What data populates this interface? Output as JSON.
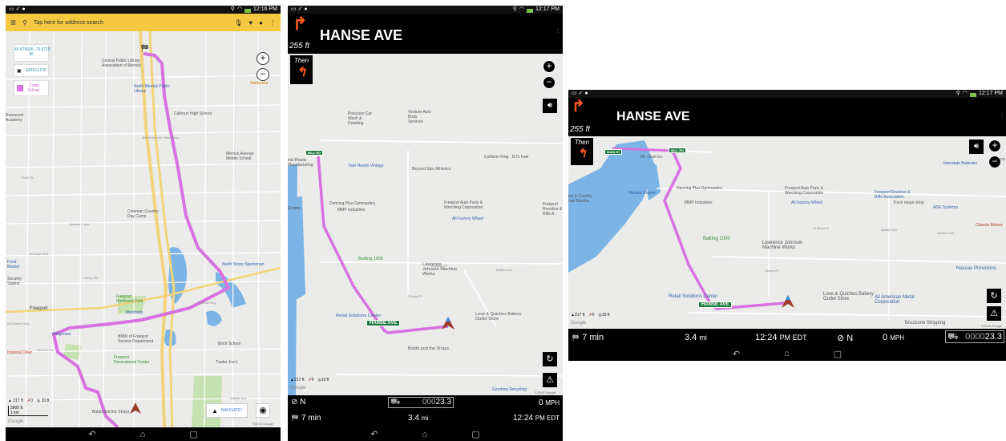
{
  "screen1": {
    "status_time": "12:16 PM",
    "search_placeholder": "Tap here for address search",
    "coords": "40.679935,-73.5710 36",
    "satellite_label": "SATELLITE",
    "route_time": "7 min",
    "route_distance": "3.4 mi",
    "navigate_label": "NAVIGATE!",
    "elevation": "217 ft",
    "violations": "0",
    "accuracy": "10 ft",
    "scale_ft": "3000 ft",
    "scale_km": "1 km",
    "google": "Google",
    "copyright": "©2019 Google",
    "pois": [
      "Central Public Library Association of Merrick",
      "North Merrick Public Library",
      "Starbucks",
      "Calhoun High School",
      "Merrick Avenue Middle School",
      "Coleman Country Day Camp",
      "Freeport Northeast Park",
      "North Shore Sportsman",
      "Marshalls",
      "Birch School",
      "Walgreens",
      "BMW of Freeport Service Department",
      "Freeport Recreational Center",
      "Trader Joe's",
      "Imperial Diner",
      "Bobbi and the Strays",
      "Freeport",
      "Food Market",
      "Security Station",
      "Roosevelt Academy"
    ],
    "streets": [
      "Front St",
      "Babylon Tpke",
      "Merrick Rd",
      "W Sunrise Hwy",
      "Atlantic Ave",
      "Brooklyn Ave",
      "Meadowbrook State Pkwy",
      "Henry Rd",
      "Sunrise Hwy"
    ]
  },
  "screen2": {
    "status_time": "12:17 PM",
    "next_distance": "255 ft",
    "next_street": "HANSE AVE",
    "then_label": "Then",
    "sign_mill": "MILL RD",
    "sign_hanse": "HANSE AVE",
    "pois": [
      "Precision Car Wash & Detailing",
      "Venture Auto Body Services",
      "Collision King",
      "BJ's Fuel",
      "Twin Hearts Vintage",
      "Beyond Epic Athletics",
      "Dancing Plus Gymnastics",
      "MMP Industries",
      "Freeport Auto Parts & Wrecking Corporation",
      "All Factory Wheel",
      "Freeport Revolver & Rifle A",
      "Batting 1000",
      "Lawrence Johnson Machine Works",
      "Retail Solutions Center",
      "Love & Quiches Bakery Outlet Store",
      "Bobbi and the Strays",
      "Gershow Recycling",
      "Empire",
      "Ind-Plastic Manufacturing"
    ],
    "streets": [
      "St Marys Pl",
      "Buffalo Ave",
      "Sidney Pl"
    ],
    "elevation": "217 ft",
    "violations": "0",
    "accuracy": "10 ft",
    "google": "Google",
    "copyright": "©2019 Google",
    "heading": "N",
    "odometer_dim": "000",
    "odometer_val": "23.3",
    "speed": "0",
    "speed_unit": "MPH",
    "time_left": "7 min",
    "dist_left": "3.4",
    "dist_unit": "mi",
    "eta": "12:24",
    "eta_unit": "PM EDT"
  },
  "screen3": {
    "status_time": "12:17 PM",
    "next_distance": "255 ft",
    "next_street": "HANSE AVE",
    "then_label": "Then",
    "sign_main": "MAIN ST",
    "sign_mill": "MILL RD",
    "sign_hanse": "HANSE AVE",
    "pois": [
      "Mr. Dock Inc",
      "Dancing Plus Gymnastics",
      "Micanis Engine",
      "MMP Industries",
      "Freeport Auto Parts & Wrecking Corporation",
      "All Factory Wheel",
      "Freeport Revolver & Rifle Association",
      "Truck repair shop",
      "ADE Systems",
      "Interstate Batteries",
      "Charvin Motors",
      "Batting 1000",
      "Lawrence Johnson Machine Works",
      "Nassau Provisions",
      "Retail Solutions Center",
      "Love & Quiches Bakery Outlet Store",
      "All American Metal Corporation",
      "Bruzzone Shipping",
      "Brama",
      "wn & Country ntal Studios"
    ],
    "streets": [
      "St Marys Pl",
      "Buffalo Ave",
      "Sidney Pl",
      "Winters Ave"
    ],
    "elevation": "217 ft",
    "violations": "0",
    "accuracy": "10 ft",
    "google": "Google",
    "copyright": "©2019 Google",
    "time_left": "7 min",
    "dist_left": "3.4",
    "dist_unit": "mi",
    "eta": "12:24",
    "eta_unit": "PM EDT",
    "heading": "N",
    "speed": "0",
    "speed_unit": "MPH",
    "odometer_dim": "0000",
    "odometer_val": "23.3"
  },
  "colors": {
    "route": "#d772e0",
    "search_bar": "#f5c842",
    "turn_arrow": "#ff5a1f",
    "sign_green": "#1f7a3d",
    "water": "#7cb4e6",
    "park": "#c5e2b0",
    "highway": "#f3d37a"
  }
}
